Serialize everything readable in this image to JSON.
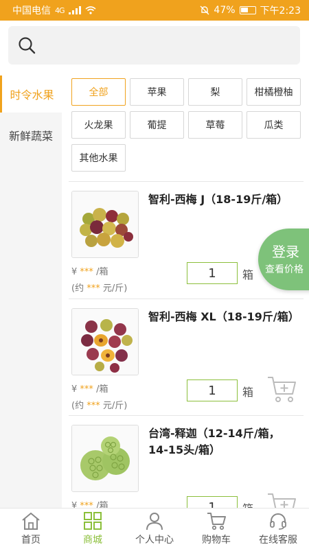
{
  "status_bar": {
    "carrier": "中国电信",
    "network": "4G",
    "battery": "47%",
    "time": "下午2:23"
  },
  "search": {
    "placeholder": ""
  },
  "categories": [
    {
      "label": "时令水果",
      "active": true
    },
    {
      "label": "新鲜蔬菜",
      "active": false
    }
  ],
  "filters": [
    {
      "label": "全部",
      "active": true
    },
    {
      "label": "苹果",
      "active": false
    },
    {
      "label": "梨",
      "active": false
    },
    {
      "label": "柑橘橙柚",
      "active": false
    },
    {
      "label": "火龙果",
      "active": false
    },
    {
      "label": "葡提",
      "active": false
    },
    {
      "label": "草莓",
      "active": false
    },
    {
      "label": "瓜类",
      "active": false
    },
    {
      "label": "其他水果",
      "active": false
    }
  ],
  "products": [
    {
      "name": "智利-西梅 J（18-19斤/箱）",
      "price_prefix": "¥",
      "price_masked": "***",
      "price_unit": "/箱",
      "unit_price_prefix": "(约",
      "unit_price_masked": "***",
      "unit_price_suffix": "元/斤)",
      "quantity": "1",
      "quantity_unit": "箱",
      "image": "plums-icon"
    },
    {
      "name": "智利-西梅 XL（18-19斤/箱）",
      "price_prefix": "¥",
      "price_masked": "***",
      "price_unit": "/箱",
      "unit_price_prefix": "(约",
      "unit_price_masked": "***",
      "unit_price_suffix": "元/斤)",
      "quantity": "1",
      "quantity_unit": "箱",
      "image": "plums-cut-icon"
    },
    {
      "name": "台湾-释迦（12-14斤/箱，14-15头/箱）",
      "price_prefix": "¥",
      "price_masked": "***",
      "price_unit": "/箱",
      "unit_price_prefix": "",
      "unit_price_masked": "",
      "unit_price_suffix": "",
      "quantity": "1",
      "quantity_unit": "箱",
      "image": "sugar-apple-icon"
    }
  ],
  "login_bubble": {
    "line1": "登录",
    "line2": "查看价格"
  },
  "nav": [
    {
      "label": "首页",
      "icon": "home-icon",
      "active": false
    },
    {
      "label": "商城",
      "icon": "grid-icon",
      "active": true
    },
    {
      "label": "个人中心",
      "icon": "user-icon",
      "active": false
    },
    {
      "label": "购物车",
      "icon": "cart-icon",
      "active": false
    },
    {
      "label": "在线客服",
      "icon": "headset-icon",
      "active": false
    }
  ],
  "colors": {
    "accent": "#f0a21d",
    "green": "#8bbf3a",
    "bubble": "#7ec27a"
  }
}
